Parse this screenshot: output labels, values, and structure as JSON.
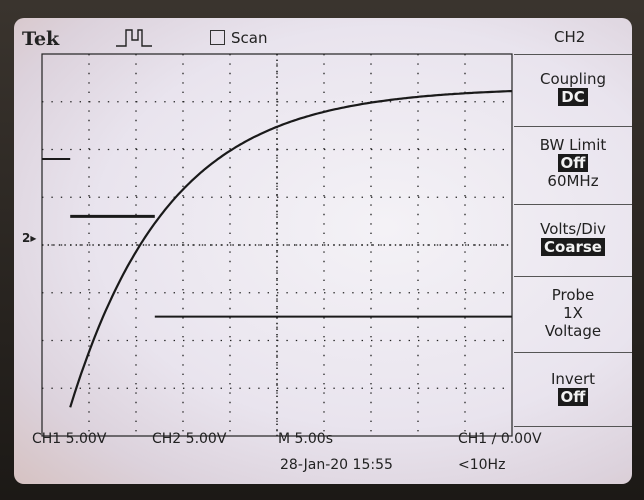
{
  "header": {
    "brand": "Tek",
    "scan_label": "Scan",
    "channel_title": "CH2"
  },
  "menu": [
    {
      "label": "Coupling",
      "value": "DC",
      "extra": ""
    },
    {
      "label": "BW Limit",
      "value": "Off",
      "extra": "60MHz"
    },
    {
      "label": "Volts/Div",
      "value": "Coarse",
      "extra": ""
    },
    {
      "label": "Probe",
      "value": "1X",
      "extra": "Voltage"
    },
    {
      "label": "Invert",
      "value": "Off",
      "extra": ""
    }
  ],
  "footer": {
    "ch1_scale": "CH1  5.00V",
    "ch2_scale": "CH2  5.00V",
    "timebase": "M 5.00s",
    "trigger": "CH1 ∕ 0.00V",
    "datetime": "28-Jan-20 15:55",
    "frequency": "<10Hz"
  },
  "markers": {
    "ch2_marker": "2"
  },
  "colors": {
    "trace": "#1a1a1a",
    "grid": "#222222",
    "highlight_bg": "#1b1b1b"
  },
  "trigger_icon": "pulse-trigger-icon",
  "traces": {
    "ch1_square_wave": {
      "description_units": "divisions",
      "segments": [
        {
          "x": [
            0.0,
            0.6
          ],
          "y": 1.8
        },
        {
          "x": [
            0.6,
            2.4
          ],
          "y": 0.6
        },
        {
          "x": [
            2.4,
            10.0
          ],
          "y": -1.5
        }
      ]
    },
    "ch2_exponential": {
      "start_x": 0.6,
      "start_y": -3.4,
      "end_x": 10.0,
      "asymptote_y": 3.3,
      "time_constant_div": 2.1
    }
  }
}
